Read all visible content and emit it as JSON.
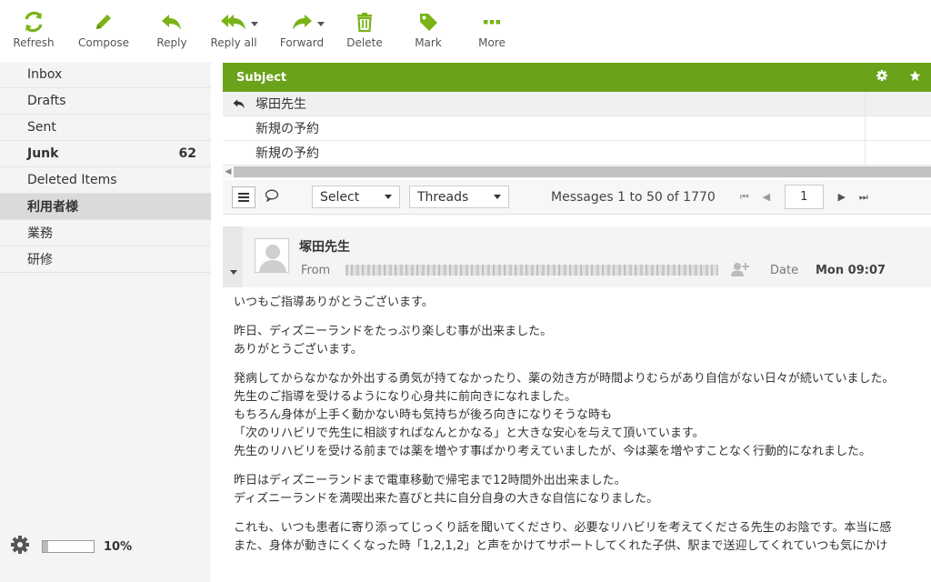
{
  "toolbar": {
    "items": [
      {
        "label": "Refresh",
        "icon": "refresh-icon"
      },
      {
        "label": "Compose",
        "icon": "pencil-icon"
      },
      {
        "label": "Reply",
        "icon": "reply-icon"
      },
      {
        "label": "Reply all",
        "icon": "reply-all-icon"
      },
      {
        "label": "Forward",
        "icon": "forward-icon"
      },
      {
        "label": "Delete",
        "icon": "trash-icon"
      },
      {
        "label": "Mark",
        "icon": "tag-icon"
      },
      {
        "label": "More",
        "icon": "more-icon"
      }
    ]
  },
  "folders": [
    {
      "name": "Inbox",
      "count": ""
    },
    {
      "name": "Drafts",
      "count": ""
    },
    {
      "name": "Sent",
      "count": ""
    },
    {
      "name": "Junk",
      "count": "62"
    },
    {
      "name": "Deleted Items",
      "count": ""
    },
    {
      "name": "利用者様",
      "count": ""
    },
    {
      "name": "業務",
      "count": ""
    },
    {
      "name": "研修",
      "count": ""
    }
  ],
  "quota": {
    "percent_text": "10%",
    "fraction": 0.1
  },
  "message_list": {
    "column_subject": "Subject",
    "rows": [
      {
        "subject": "塚田先生"
      },
      {
        "subject": "新規の予約"
      },
      {
        "subject": "新規の予約"
      }
    ]
  },
  "list_footer": {
    "select_label": "Select",
    "threads_label": "Threads",
    "count_info": "Messages 1 to 50 of 1770",
    "page": "1"
  },
  "preview": {
    "subject": "塚田先生",
    "from_label": "From",
    "date_label": "Date",
    "date_value": "Mon 09:07"
  },
  "body": {
    "lines": [
      "いつもご指導ありがとうございます。",
      "昨日、ディズニーランドをたっぷり楽しむ事が出来ました。",
      "ありがとうございます。",
      "発病してからなかなか外出する勇気が持てなかったり、薬の効き方が時間よりむらがあり自信がない日々が続いていました。",
      "先生のご指導を受けるようになり心身共に前向きになれました。",
      "もちろん身体が上手く動かない時も気持ちが後ろ向きになりそうな時も",
      "「次のリハビリで先生に相談すればなんとかなる」と大きな安心を与えて頂いています。",
      "先生のリハビリを受ける前までは薬を増やす事ばかり考えていましたが、今は薬を増やすことなく行動的になれました。",
      "昨日はディズニーランドまで電車移動で帰宅まで12時間外出出来ました。",
      "ディズニーランドを満喫出来た喜びと共に自分自身の大きな自信になりました。",
      "これも、いつも患者に寄り添ってじっくり話を聞いてくださり、必要なリハビリを考えてくださる先生のお陰です。本当に感",
      "また、身体が動きにくくなった時「1,2,1,2」と声をかけてサポートしてくれた子供、駅まで送迎してくれていつも気にかけ"
    ]
  },
  "colors": {
    "accent": "#6aa21a",
    "icon": "#7ab317"
  }
}
